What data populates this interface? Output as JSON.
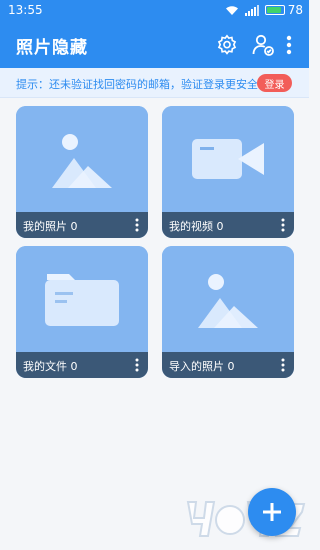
{
  "status": {
    "time": "13:55",
    "battery": "78"
  },
  "app": {
    "title": "照片隐藏"
  },
  "icons": {
    "settings": "gear-icon",
    "account": "user-check-icon",
    "more": "more-vertical-icon"
  },
  "notice": {
    "text": "提示：还未验证找回密码的邮箱，验证登录更安全",
    "login_label": "登录"
  },
  "tiles": [
    {
      "label": "我的照片 0",
      "icon": "image-icon"
    },
    {
      "label": "我的视频 0",
      "icon": "video-camera-icon"
    },
    {
      "label": "我的文件 0",
      "icon": "folder-icon"
    },
    {
      "label": "导入的照片 0",
      "icon": "image-icon"
    }
  ],
  "fab": {
    "label": "+"
  },
  "colors": {
    "primary": "#2d8cf0",
    "tile_bg": "#83b5f0",
    "tile_bar": "#3b5877",
    "login_button": "#f25d59"
  }
}
